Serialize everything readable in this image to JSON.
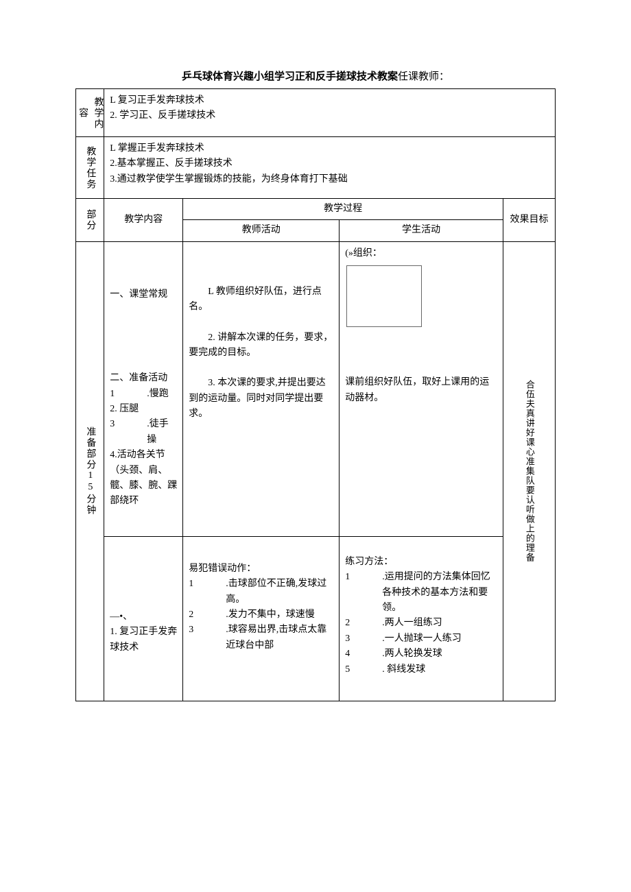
{
  "title": "乒乓球体育兴趣小组学习正和反手搓球技术教案",
  "teacher_label": "任课教师：",
  "labels": {
    "teaching_content": "教学内容",
    "teaching_task": "教学任务",
    "section": "部分",
    "teaching_content2": "教学内容",
    "process": "教学过程",
    "teacher_activity": "教师活动",
    "student_activity": "学生活动",
    "effect": "效果目标"
  },
  "teaching_content": {
    "line1": "L 复习正手发奔球技术",
    "line2": "2. 学习正、反手搓球技术"
  },
  "teaching_task": {
    "line1": "L 掌握正手发奔球技术",
    "line2": "2.基本掌握正、反手搓球技术",
    "line3": "3.通过教学使学生掌握锻炼的技能，为终身体育打下基础"
  },
  "prep": {
    "section_label": "准备部分15分钟",
    "content": {
      "item1": "一、课堂常规",
      "item2_title": "二、准备活动",
      "i2_1n": "1",
      "i2_1t": ".慢跑",
      "i2_2": "2. 压腿",
      "i2_3n": "3",
      "i2_3t": ".徒手操",
      "i2_4": "4.活动各关节（头颈、肩、髋、膝、腕、踝部绕环"
    },
    "teacher": {
      "p1": "L 教师组织好队伍，进行点名。",
      "p2": "2. 讲解本次课的任务，要求，要完成的目标。",
      "p3": "3. 本次课的要求,并提出要达到的运动量。同时对同学提出要求。"
    },
    "student": {
      "org": "(»组织：",
      "desc": "课前组织好队伍，取好上课用的运动器材。"
    },
    "effect": "合伍夫真讲好课心准集队要认听做上的理备"
  },
  "main": {
    "content": {
      "h1": "—•、",
      "t1": "1. 复习正手发奔球技术"
    },
    "teacher": {
      "head": "易犯错误动作：",
      "n1": "1",
      "t1": ".击球部位不正确,发球过高。",
      "n2": "2",
      "t2": ".发力不集中，球速慢",
      "n3": "3",
      "t3": ".球容易出界,击球点太靠近球台中部"
    },
    "student": {
      "head": "练习方法：",
      "n1": "1",
      "t1": ".运用提问的方法集体回忆各种技术的基本方法和要领。",
      "n2": "2",
      "t2": ".两人一组练习",
      "n3": "3",
      "t3": ".一人抛球一人练习",
      "n4": "4",
      "t4": ".两人轮换发球",
      "n5": "5",
      "t5": ". 斜线发球"
    }
  }
}
